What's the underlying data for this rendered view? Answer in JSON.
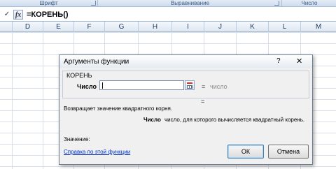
{
  "ribbon": {
    "groups": [
      "Шрифт",
      "Выравнивание",
      "Число"
    ]
  },
  "formula_bar": {
    "enter_icon": "check-icon",
    "enter_glyph": "✓",
    "fx_label": "fx",
    "formula": "=КОРЕНЬ()"
  },
  "columns": [
    "D",
    "E",
    "F",
    "G",
    "H",
    "I",
    "J",
    "K",
    "L",
    "M"
  ],
  "dialog": {
    "title": "Аргументы функции",
    "help_glyph": "?",
    "close_glyph": "✕",
    "function_name": "КОРЕНЬ",
    "argument": {
      "label": "Число",
      "value": "",
      "eq": "=",
      "result_hint": "число"
    },
    "result_eq": "=",
    "description": "Возвращает значение квадратного корня.",
    "argument_description": {
      "name": "Число",
      "text": "число, для которого вычисляется квадратный корень."
    },
    "value_label": "Значение:",
    "help_link": "Справка по этой функции",
    "ok_label": "ОК",
    "cancel_label": "Отмена"
  },
  "colors": {
    "ribbon_text": "#3b5a82",
    "link": "#0033cc",
    "hint": "#8a8a8a"
  }
}
